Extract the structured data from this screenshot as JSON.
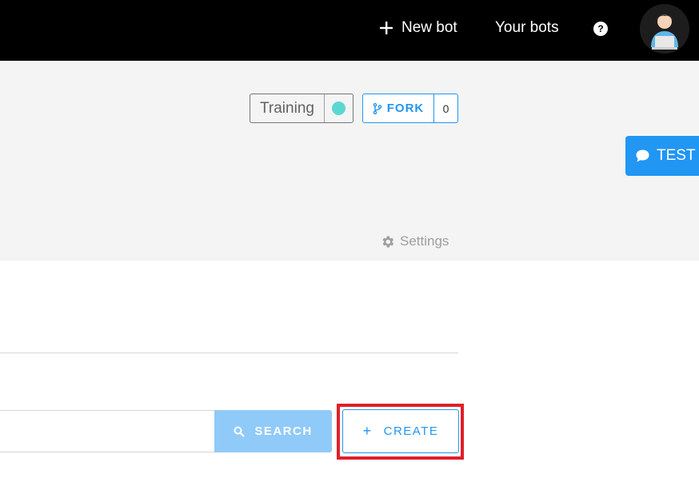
{
  "topbar": {
    "new_bot_label": "New bot",
    "your_bots_label": "Your bots",
    "help_symbol": "?",
    "background": "#000000"
  },
  "bot_header": {
    "status_label": "Training",
    "status_dot_color": "#5ad7d3",
    "fork_label": "FORK",
    "fork_count": "0",
    "test_label": "TEST",
    "settings_label": "Settings"
  },
  "search": {
    "input_value": "",
    "input_placeholder": "",
    "button_label": "SEARCH",
    "button_color": "#90caf9"
  },
  "create": {
    "button_label": "CREATE",
    "highlight_color": "#e0202a"
  },
  "colors": {
    "accent": "#2196f3",
    "panel_background": "#f4f4f4"
  },
  "icons": [
    "plus-icon",
    "help-icon",
    "avatar",
    "fork-icon",
    "chat-bubble-icon",
    "gear-icon",
    "search-icon",
    "plus-icon"
  ]
}
